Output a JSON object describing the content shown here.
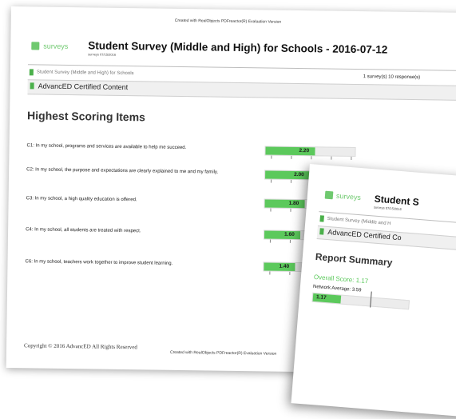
{
  "page1": {
    "watermark_top": "Created with RealObjects PDFreactor(R) Evaluation Version",
    "logo_text": "surveys",
    "title": "Student Survey (Middle and High) for Schools - 2016-07-12",
    "subdate": "surveys 07/15/2016",
    "breadcrumb": "Student Survey (Middle and High) for Schools",
    "meta": "1 survey(s)  10 response(s)",
    "certified": "AdvancED Certified Content",
    "heading": "Highest Scoring Items",
    "items": [
      {
        "text": "C1: In my school, programs and services are available to help me succeed.",
        "score": "2.20",
        "value": 2.2
      },
      {
        "text": "C2: In my school, the purpose and expectations are clearly explained to me and my family.",
        "score": "2.00",
        "value": 2.0
      },
      {
        "text": "C3: In my school, a high quality education is offered.",
        "score": "1.80",
        "value": 1.8
      },
      {
        "text": "C4: In my school, all students are treated with respect.",
        "score": "1.60",
        "value": 1.6
      },
      {
        "text": "C6: In my school, teachers work together to improve student learning.",
        "score": "1.40",
        "value": 1.4
      }
    ],
    "scale_max": 4,
    "footer_left": "Copyright © 2016 AdvancED All Rights Reserved",
    "footer_watermark": "Created with RealObjects PDFreactor(R) Evaluation Version"
  },
  "page2": {
    "logo_text": "surveys",
    "title": "Student S",
    "subdate": "surveys 07/15/2016",
    "breadcrumb": "Student Survey (Middle and H",
    "certified": "AdvancED Certified Co",
    "heading": "Report Summary",
    "overall": "Overall Score: 1.17",
    "network": "Network Average: 3.59",
    "bar_score": "1.17",
    "bar_value": 1.17
  },
  "colors": {
    "accent": "#5cc95c",
    "logo": "#6fc96f"
  }
}
